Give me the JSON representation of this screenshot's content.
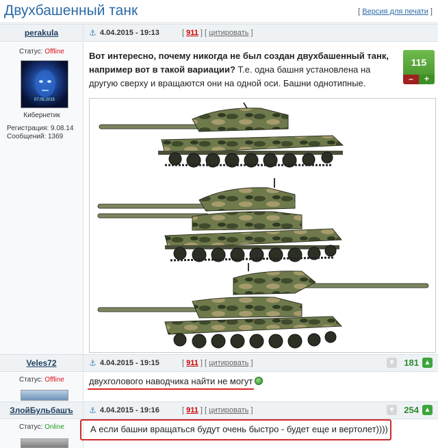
{
  "page": {
    "title": "Двухбашенный танк",
    "print_prefix": "[ ",
    "print_link": "Версия для печати",
    "print_suffix": " ]"
  },
  "posts": [
    {
      "author": "perakula",
      "date": "4.04.2015 - 19:13",
      "post_num": "911",
      "quote_label": "цитировать",
      "status_label": "Статус:",
      "status_value": "Offline",
      "avatar_date": "07.05.2015",
      "rank": "Кибернетик",
      "reg_label": "Регистрация: 9.08.14",
      "messages_label": "Сообщений: 1369",
      "text_bold": "Вот интересно, почему никогда не был создан двухбашенный танк, например вот в такой вариации?",
      "text_normal": " Т.е. одна башня установлена на другую сверху и вращаются они на одной оси. Башни однотипные.",
      "rating": "115",
      "rating_minus": "–",
      "rating_plus": "+"
    },
    {
      "author": "Veles72",
      "date": "4.04.2015 - 19:15",
      "post_num": "911",
      "quote_label": "цитировать",
      "status_label": "Статус:",
      "status_value": "Offline",
      "text": "двухголового наводчика найти не могут",
      "rating": "181"
    },
    {
      "author": "ЗлойБульбашъ",
      "date": "4.04.2015 - 19:16",
      "post_num": "911",
      "quote_label": "цитировать",
      "status_label": "Статус:",
      "status_value": "Online",
      "text": "А если башни вращаться будут очень быстро - будет еще и вертолет))))",
      "rating": "254"
    }
  ],
  "icons": {
    "anchor": "anchor-icon",
    "minus": "thumb-down-icon",
    "plus": "thumb-up-icon",
    "smiley": "globe-smiley-icon"
  },
  "colors": {
    "title_blue": "#2a6aa6",
    "offline_red": "#dd1122",
    "online_green": "#2a9a2a",
    "rating_green": "#2e8b2e",
    "highlight_red": "#cf2a2a"
  }
}
